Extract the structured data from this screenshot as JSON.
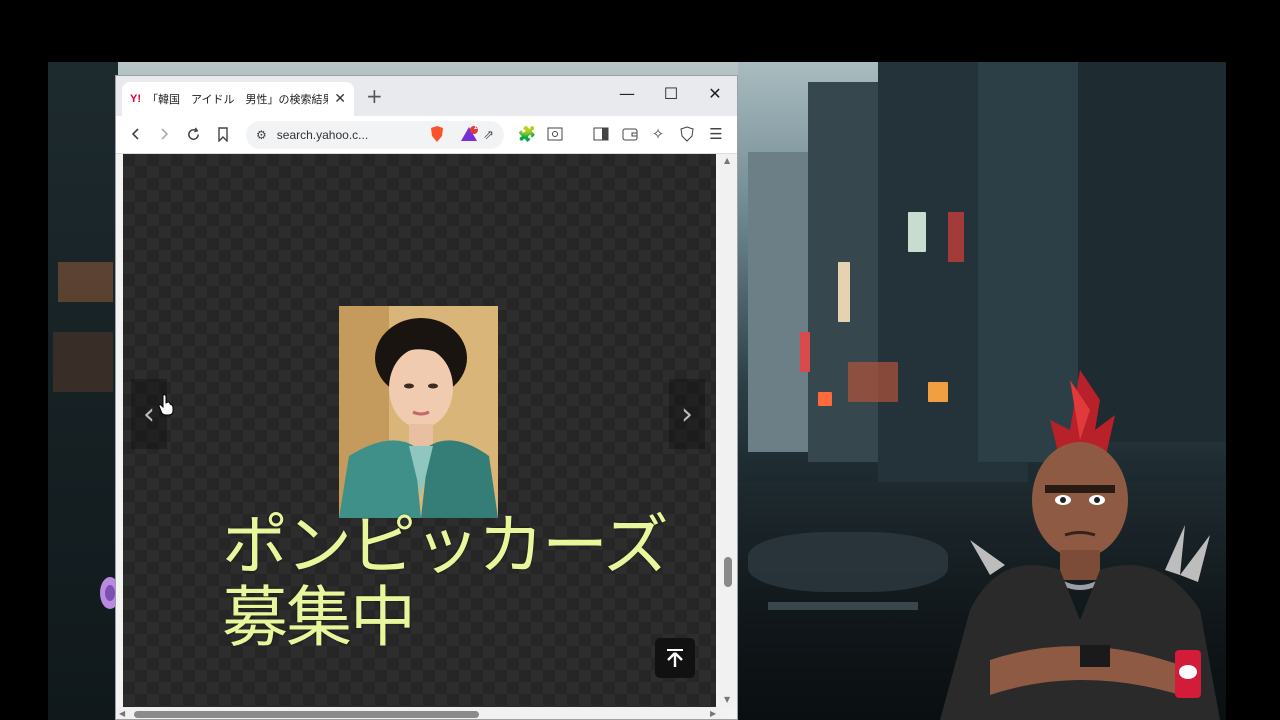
{
  "browser": {
    "tab": {
      "favicon_text": "Y!",
      "title": "「韓国　アイドル　男性」の検索結果",
      "close_icon": "close-icon"
    },
    "new_tab_label": "+",
    "window_controls": {
      "minimize": "—",
      "maximize": "☐",
      "close": "✕"
    },
    "toolbar": {
      "url": "search.yahoo.c...",
      "notification_badge": "1"
    }
  },
  "viewer": {
    "prev_arrow": "‹",
    "next_arrow": "›",
    "scroll_top_icon": "arrow-to-top-icon"
  },
  "overlay": {
    "line1": "ポンピッカーズ",
    "line2": "募集中"
  },
  "colors": {
    "overlay_text": "#e9f79c",
    "viewer_bg": "#262626",
    "brave_orange": "#fb542b",
    "yahoo_red": "#e60033"
  }
}
